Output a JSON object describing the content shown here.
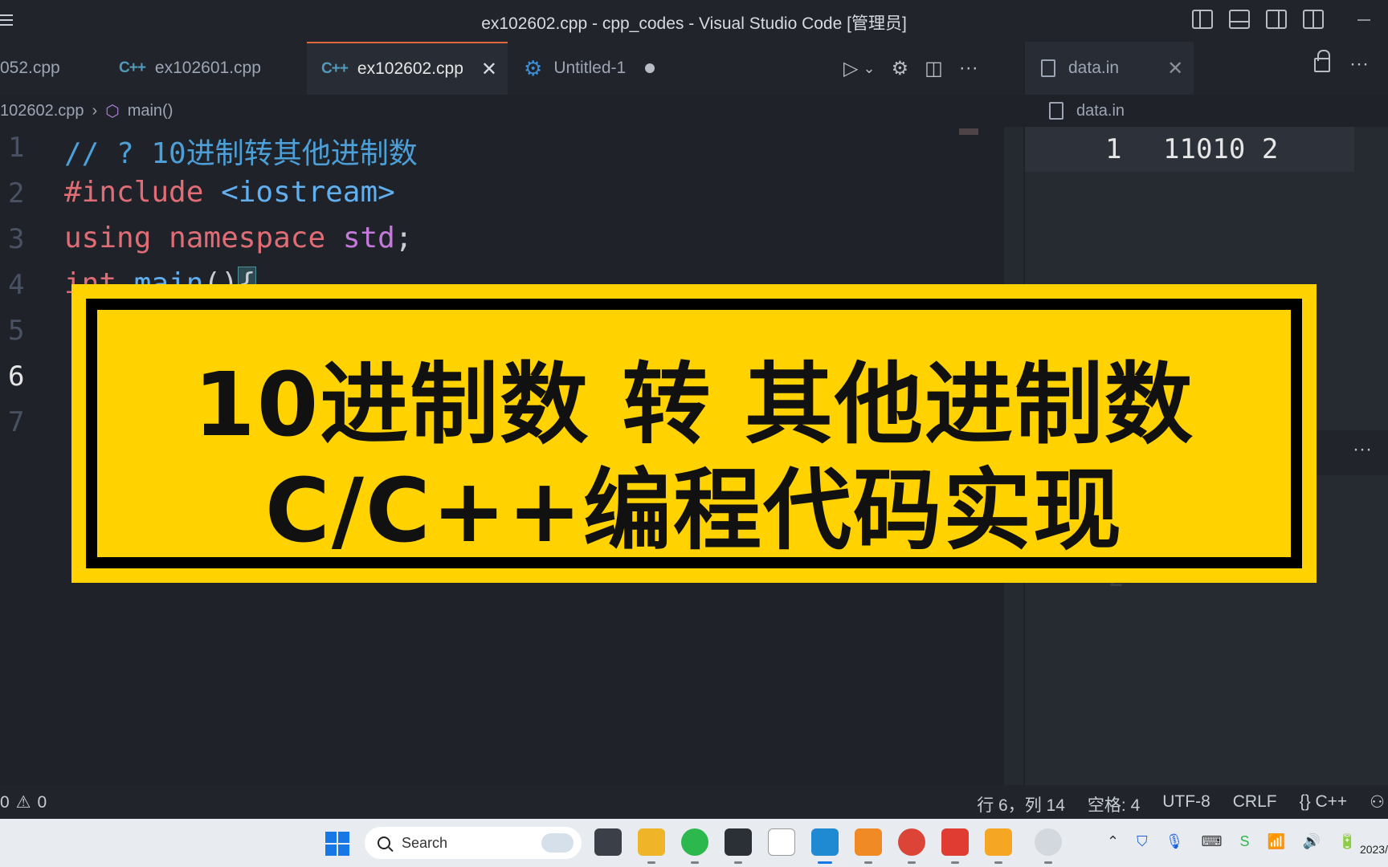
{
  "window": {
    "title": "ex102602.cpp - cpp_codes - Visual Studio Code [管理员]"
  },
  "tabs": [
    {
      "label": "052.cpp"
    },
    {
      "label": "ex102601.cpp"
    },
    {
      "label": "ex102602.cpp"
    },
    {
      "label": "Untitled-1"
    }
  ],
  "icons": {
    "cpp": "C++",
    "close": "✕",
    "run": "▷",
    "chevron": "⌄",
    "gear": "⚙",
    "split": "◫",
    "more": "···"
  },
  "breadcrumb": {
    "file": "102602.cpp",
    "symbol": "main()"
  },
  "code": {
    "lines": [
      {
        "num": "1",
        "text": "// ? 10进制转其他进制数"
      },
      {
        "num": "2",
        "kw": "#include",
        "inc": "<iostream>"
      },
      {
        "num": "3",
        "kw1": "using",
        "kw2": "namespace",
        "type": "std",
        "punc": ";"
      },
      {
        "num": "4",
        "kw": "int",
        "fn": "main",
        "punc": "()",
        "brace": "{"
      },
      {
        "num": "5"
      },
      {
        "num": "6"
      },
      {
        "num": "7"
      }
    ]
  },
  "right_panel": {
    "tab": "data.in",
    "breadcrumb": "data.in",
    "line_num": "1",
    "line_text": "11010 2",
    "faded_num": "2"
  },
  "banner": {
    "line1": "10进制数 转 其他进制数",
    "line2": "C/C++编程代码实现"
  },
  "statusbar": {
    "errors": "0",
    "warnings": "0",
    "position": "行 6，列 14",
    "spaces": "空格: 4",
    "encoding": "UTF-8",
    "eol": "CRLF",
    "language": "{} C++"
  },
  "taskbar": {
    "search_placeholder": "Search",
    "clock": "2023/"
  }
}
